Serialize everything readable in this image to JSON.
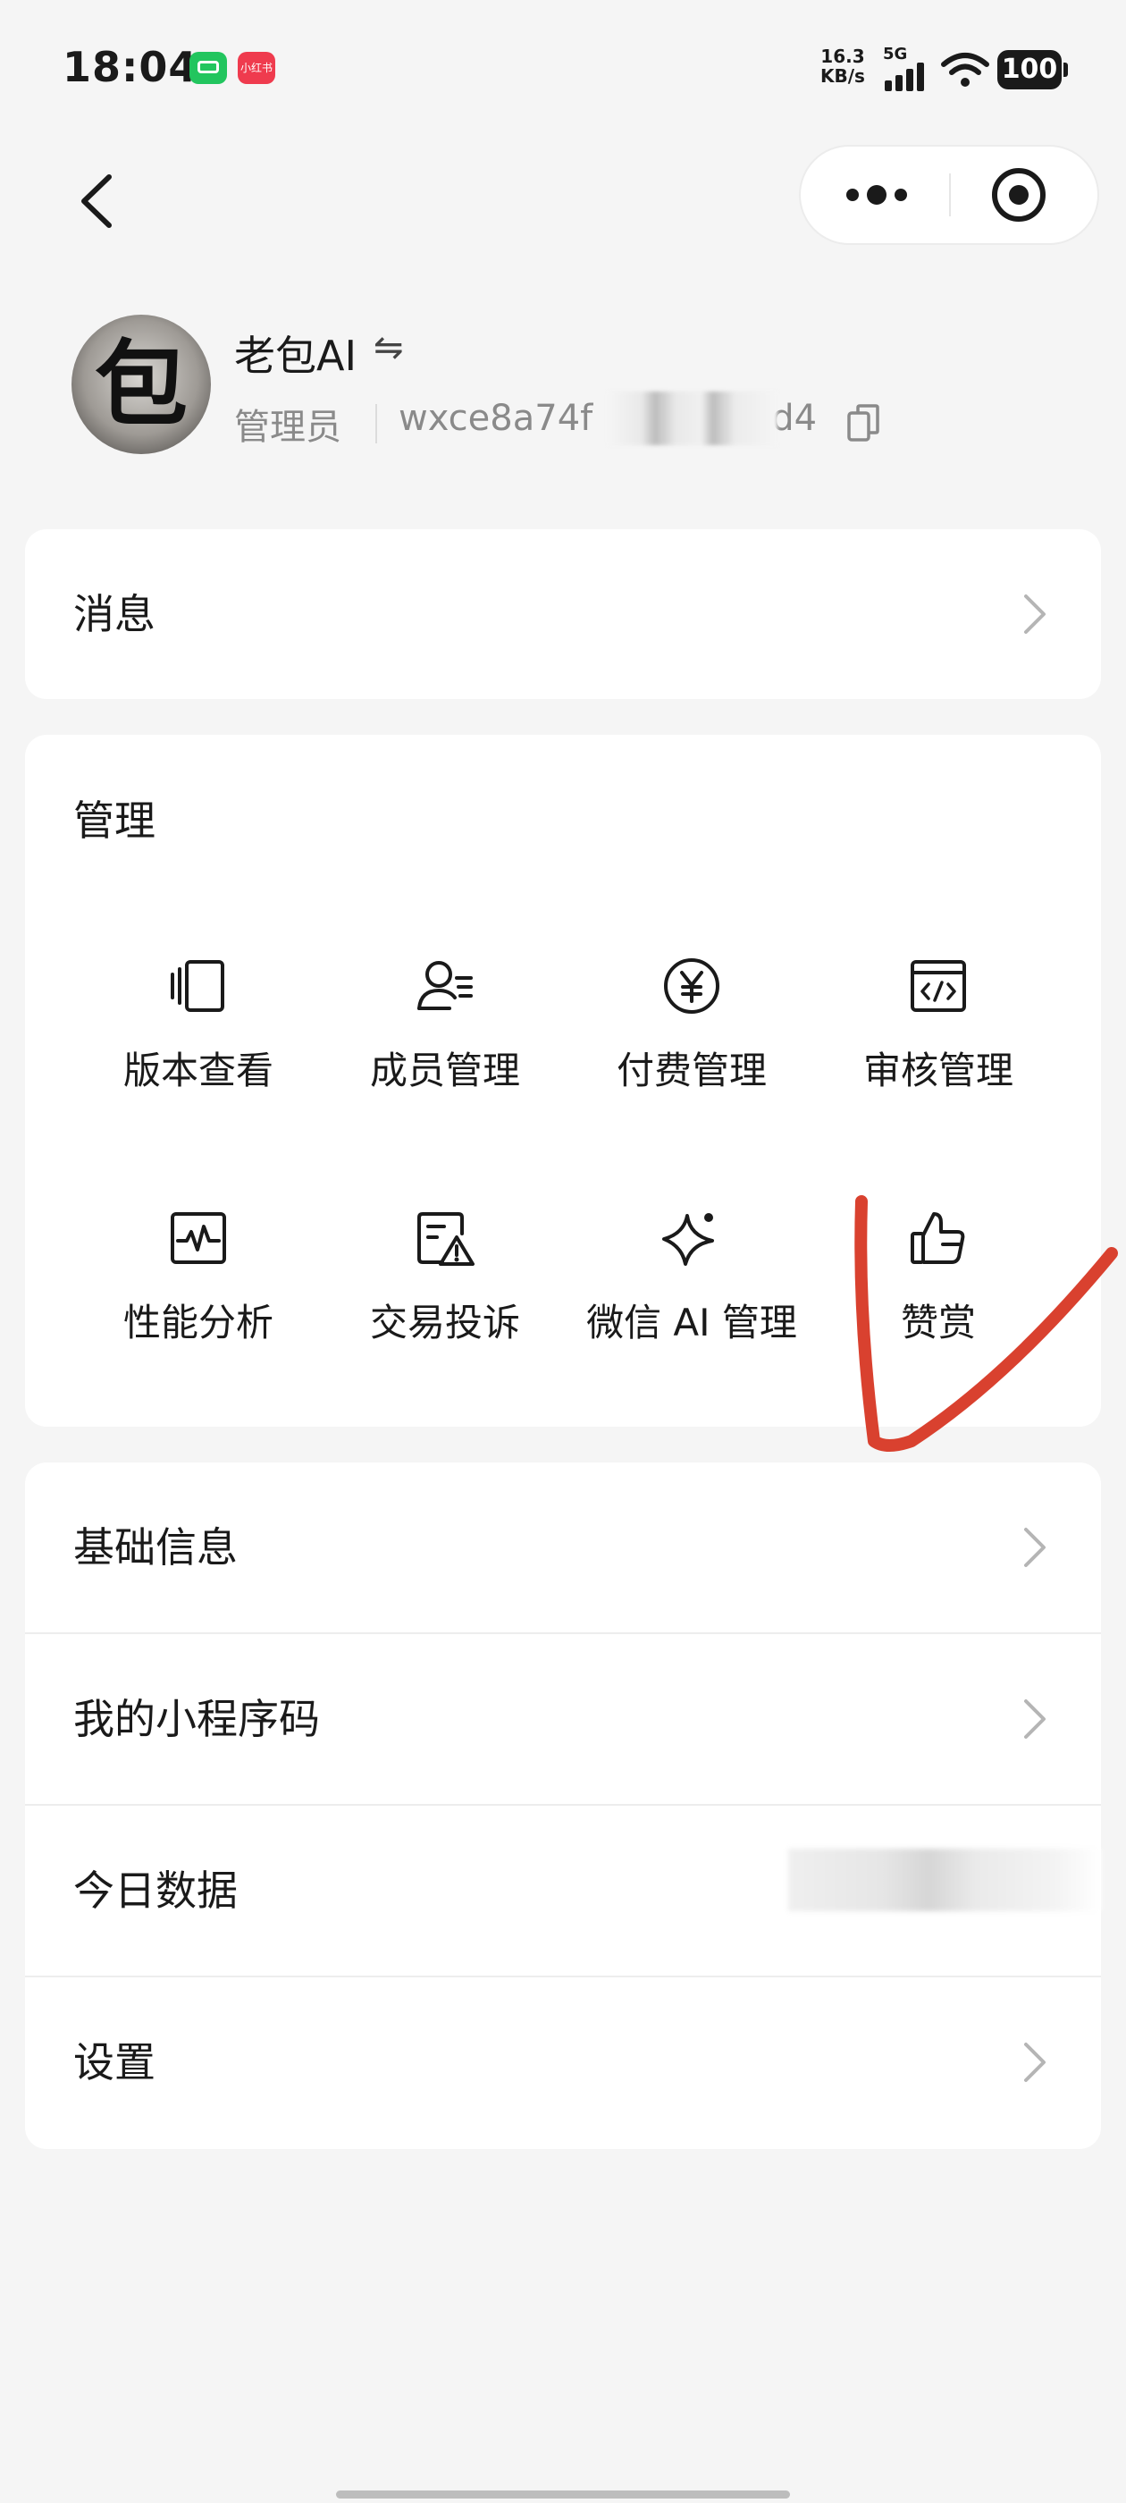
{
  "status_bar": {
    "time": "18:04",
    "badge_app": "小红书",
    "net_speed_value": "16.3",
    "net_speed_unit": "KB/s",
    "signal_type": "5G",
    "battery": "100"
  },
  "profile": {
    "name": "老包AI",
    "swap_symbol": "⇋",
    "avatar_glyph": "包",
    "role": "管理员",
    "app_id": "wxce8a74f",
    "app_id_tail": "d4"
  },
  "messages": {
    "label": "消息"
  },
  "management": {
    "title": "管理",
    "items": [
      {
        "label": "版本查看",
        "icon": "versions-icon"
      },
      {
        "label": "成员管理",
        "icon": "members-icon"
      },
      {
        "label": "付费管理",
        "icon": "yen-icon"
      },
      {
        "label": "审核管理",
        "icon": "code-review-icon"
      },
      {
        "label": "性能分析",
        "icon": "performance-icon"
      },
      {
        "label": "交易投诉",
        "icon": "complaint-icon"
      },
      {
        "label": "微信 AI 管理",
        "icon": "sparkle-icon"
      },
      {
        "label": "赞赏",
        "icon": "thumbs-up-icon"
      }
    ]
  },
  "list": {
    "basic_info": "基础信息",
    "mini_program_code": "我的小程序码",
    "today_data": "今日数据",
    "settings": "设置"
  },
  "colors": {
    "annotation_red": "#d9412f",
    "background": "#f5f5f5",
    "card": "#ffffff"
  }
}
